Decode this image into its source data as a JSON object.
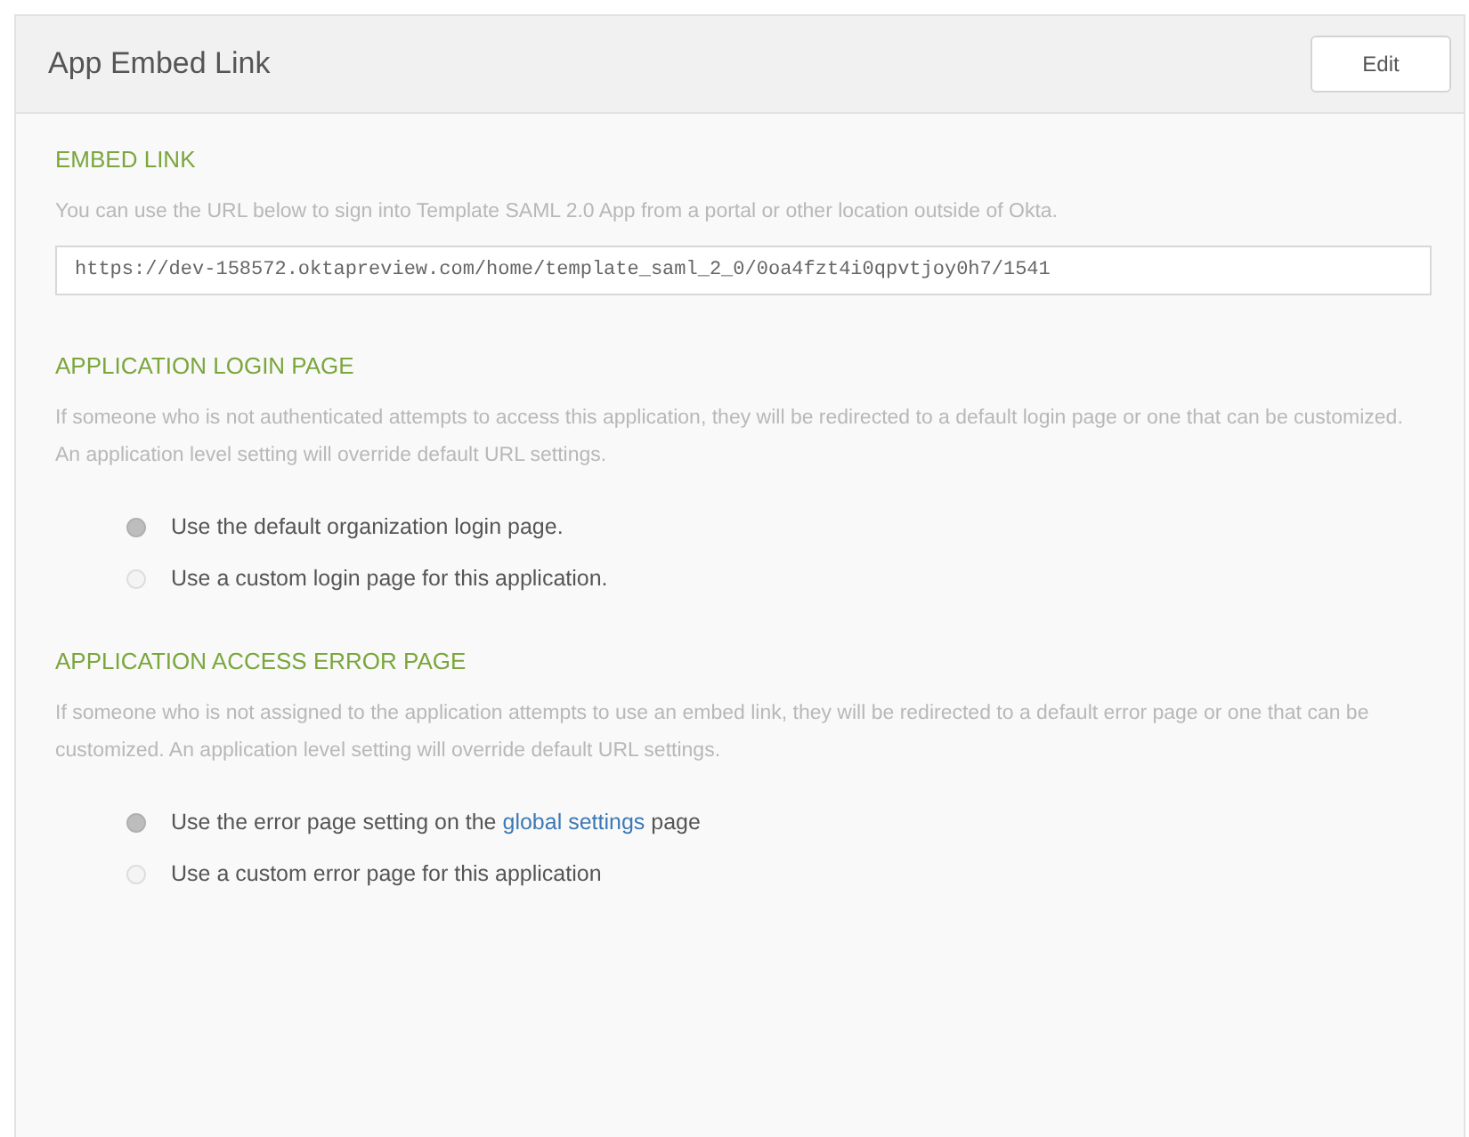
{
  "header": {
    "title": "App Embed Link",
    "button": "Edit"
  },
  "sections": [
    {
      "kind": "link",
      "heading": "EMBED LINK",
      "description": "You can use the URL below to sign into Template SAML 2.0 App from a portal or other location outside of Okta.",
      "value": "https://dev-158572.oktapreview.com/home/template_saml_2_0/0oa4fzt4i0qpvtjoy0h7/1541"
    },
    {
      "kind": "radios",
      "heading": "APPLICATION LOGIN PAGE",
      "description": "If someone who is not authenticated attempts to access this application, they will be redirected to a default login page or one that can be customized. An application level setting will override default URL settings.",
      "options": [
        {
          "label": "Use the default organization login page.",
          "selected": true
        },
        {
          "label": "Use a custom login page for this application.",
          "selected": false
        }
      ]
    },
    {
      "kind": "radios",
      "heading": "APPLICATION ACCESS ERROR PAGE",
      "description": "If someone who is not assigned to the application attempts to use an embed link, they will be redirected to a default error page or one that can be customized. An application level setting will override default URL settings.",
      "options": [
        {
          "label": "Use the error page setting on the",
          "link": "global settings",
          "label_after": "page",
          "selected": true
        },
        {
          "label": "Use a custom error page for this application",
          "selected": false
        }
      ]
    }
  ]
}
